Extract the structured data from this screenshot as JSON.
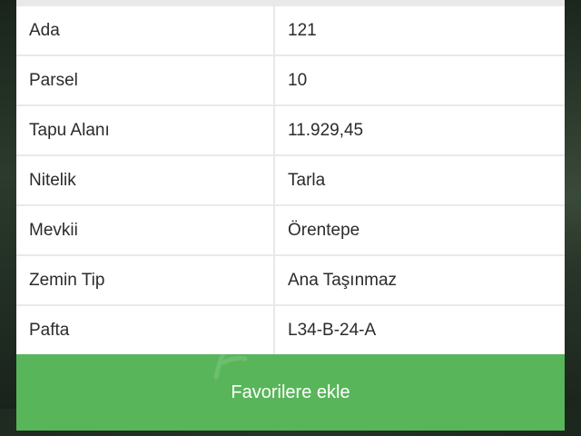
{
  "details": {
    "rows": [
      {
        "key": "Ada",
        "value": "121"
      },
      {
        "key": "Parsel",
        "value": "10"
      },
      {
        "key": "Tapu Alanı",
        "value": "11.929,45"
      },
      {
        "key": "Nitelik",
        "value": "Tarla"
      },
      {
        "key": "Mevkii",
        "value": "Örentepe"
      },
      {
        "key": "Zemin Tip",
        "value": "Ana Taşınmaz"
      },
      {
        "key": "Pafta",
        "value": "L34-B-24-A"
      }
    ]
  },
  "actions": {
    "favorite_label": "Favorilere ekle"
  },
  "colors": {
    "button_green": "#59b55a",
    "row_background": "#ffffff",
    "separator": "#e9e9e9"
  }
}
